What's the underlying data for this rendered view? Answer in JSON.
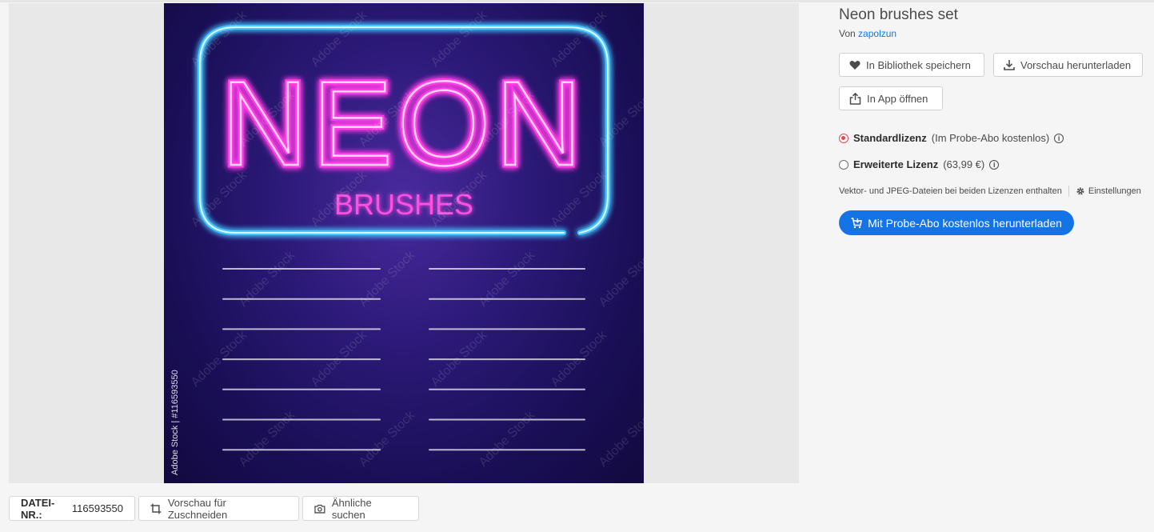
{
  "asset": {
    "title": "Neon brushes set",
    "by_prefix": "Von",
    "author": "zapolzun",
    "preview": {
      "main_word": "NEON",
      "sub_word": "BRUSHES",
      "watermark": "Adobe Stock",
      "vertical_id": "Adobe Stock | #116593550",
      "stroke_colors_left": [
        "#ffffff",
        "#ff5a3c",
        "#ff9b2a",
        "#ffb35c",
        "#ffe02a",
        "#8cff3a",
        "#3affd2"
      ],
      "stroke_colors_right": [
        "#57d9ff",
        "#5a8cff",
        "#c45aff",
        "#e85aff",
        "#ff4fd8",
        "#ff9de8",
        "#ff8f7a"
      ]
    }
  },
  "actions": {
    "save_library": "In Bibliothek speichern",
    "download_preview": "Vorschau herunterladen",
    "open_in_app": "In App öffnen"
  },
  "license": {
    "standard_label": "Standardlizenz",
    "standard_note": "(Im Probe-Abo kostenlos)",
    "extended_label": "Erweiterte Lizenz",
    "extended_note": "(63,99 €)",
    "selected": "standard"
  },
  "file_info": {
    "included_text": "Vektor- und JPEG-Dateien bei beiden Lizenzen enthalten",
    "settings_label": "Einstellungen"
  },
  "cta": {
    "label": "Mit Probe-Abo kostenlos herunterladen",
    "color": "#1473e6"
  },
  "bottom_bar": {
    "file_no_label": "DATEI-NR.:",
    "file_no_value": "116593550",
    "crop_preview": "Vorschau für Zuschneiden",
    "find_similar": "Ähnliche suchen"
  }
}
